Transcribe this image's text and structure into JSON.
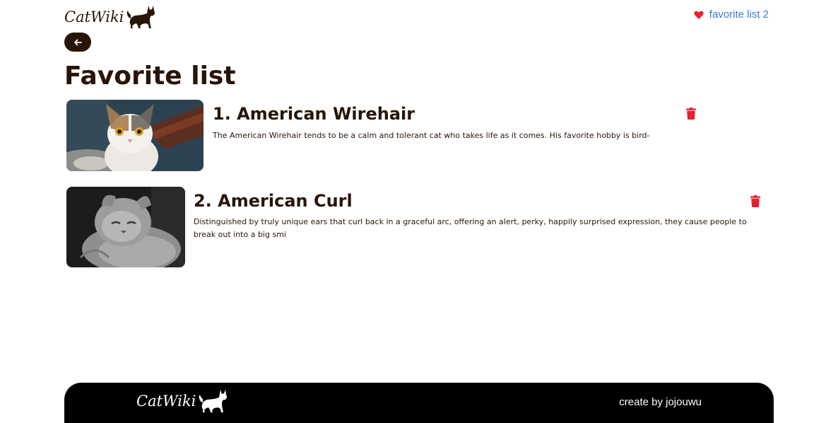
{
  "header": {
    "logo_text": "CatWiki",
    "favorite_link": "favorite list 2"
  },
  "page_title": "Favorite list",
  "favorites": [
    {
      "title": "1. American Wirehair",
      "description": "The American Wirehair tends to be a calm and tolerant cat who takes life as it comes. His favorite hobby is bird-"
    },
    {
      "title": "2. American Curl",
      "description": "Distinguished by truly unique ears that curl back in a graceful arc, offering an alert, perky, happily surprised expression, they cause people to break out into a big smi"
    }
  ],
  "footer": {
    "logo_text": "CatWiki",
    "credit": "create by jojouwu"
  },
  "colors": {
    "brand_dark": "#291507",
    "link_blue": "#3b7ad8",
    "delete_red": "#e8202f",
    "heart_red": "#e8202f",
    "footer_bg": "#000000"
  },
  "icons": {
    "logo": "cat-silhouette-icon",
    "favorite": "heart-icon",
    "back": "arrow-left-icon",
    "delete": "trash-icon"
  }
}
